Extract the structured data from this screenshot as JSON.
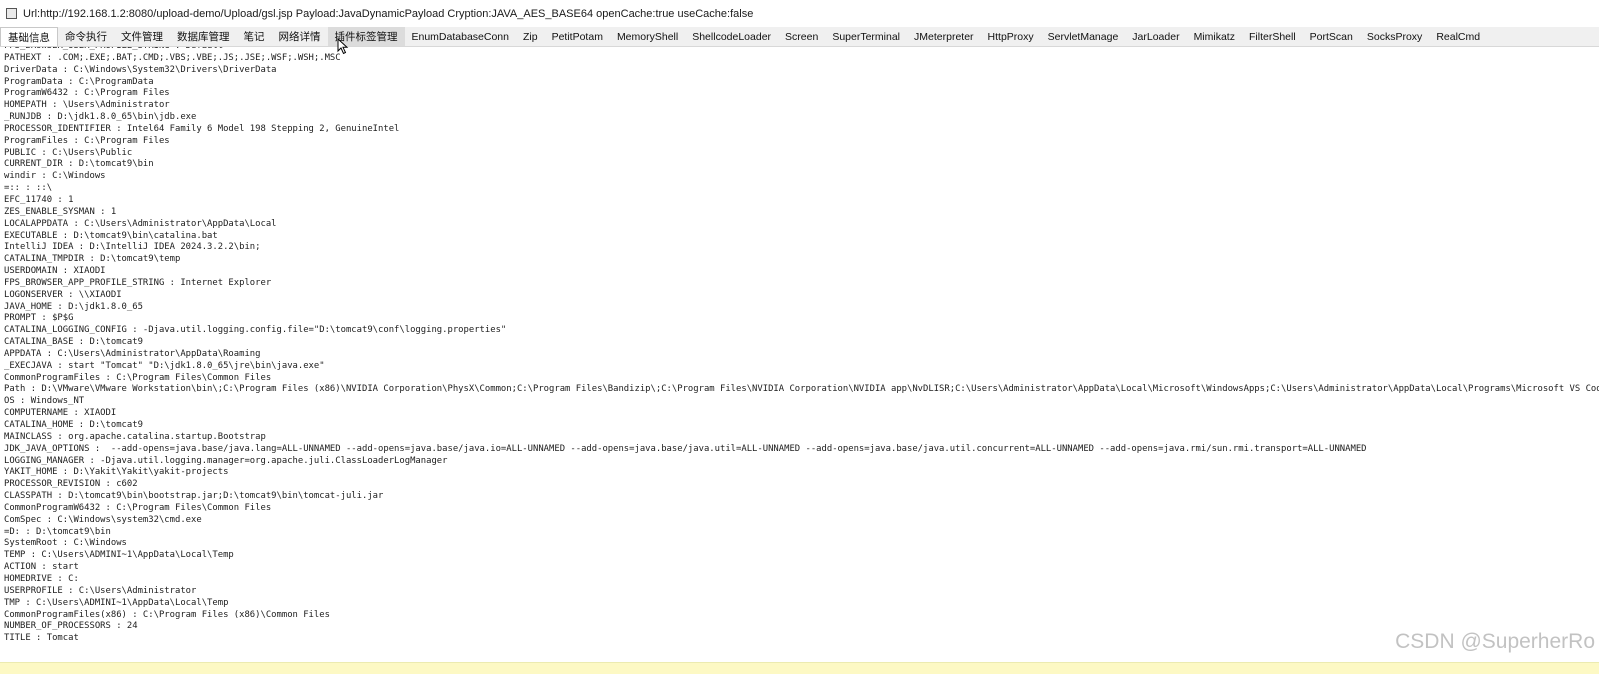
{
  "window": {
    "title": "Url:http://192.168.1.2:8080/upload-demo/Upload/gsl.jsp Payload:JavaDynamicPayload Cryption:JAVA_AES_BASE64 openCache:true useCache:false",
    "app_icon": "window-app-icon"
  },
  "tabs": [
    {
      "label": "基础信息",
      "state": "active"
    },
    {
      "label": "命令执行",
      "state": "normal"
    },
    {
      "label": "文件管理",
      "state": "normal"
    },
    {
      "label": "数据库管理",
      "state": "normal"
    },
    {
      "label": "笔记",
      "state": "normal"
    },
    {
      "label": "网络详情",
      "state": "normal"
    },
    {
      "label": "插件标签管理",
      "state": "hover"
    },
    {
      "label": "EnumDatabaseConn",
      "state": "normal"
    },
    {
      "label": "Zip",
      "state": "normal"
    },
    {
      "label": "PetitPotam",
      "state": "normal"
    },
    {
      "label": "MemoryShell",
      "state": "normal"
    },
    {
      "label": "ShellcodeLoader",
      "state": "normal"
    },
    {
      "label": "Screen",
      "state": "normal"
    },
    {
      "label": "SuperTerminal",
      "state": "normal"
    },
    {
      "label": "JMeterpreter",
      "state": "normal"
    },
    {
      "label": "HttpProxy",
      "state": "normal"
    },
    {
      "label": "ServletManage",
      "state": "normal"
    },
    {
      "label": "JarLoader",
      "state": "normal"
    },
    {
      "label": "Mimikatz",
      "state": "normal"
    },
    {
      "label": "FilterShell",
      "state": "normal"
    },
    {
      "label": "PortScan",
      "state": "normal"
    },
    {
      "label": "SocksProxy",
      "state": "normal"
    },
    {
      "label": "RealCmd",
      "state": "normal"
    }
  ],
  "output_lines": [
    "FPS_BROWSER_USER_PROFILE_STRING : Default",
    "PATHEXT : .COM;.EXE;.BAT;.CMD;.VBS;.VBE;.JS;.JSE;.WSF;.WSH;.MSC",
    "DriverData : C:\\Windows\\System32\\Drivers\\DriverData",
    "ProgramData : C:\\ProgramData",
    "ProgramW6432 : C:\\Program Files",
    "HOMEPATH : \\Users\\Administrator",
    "_RUNJDB : D:\\jdk1.8.0_65\\bin\\jdb.exe",
    "PROCESSOR_IDENTIFIER : Intel64 Family 6 Model 198 Stepping 2, GenuineIntel",
    "ProgramFiles : C:\\Program Files",
    "PUBLIC : C:\\Users\\Public",
    "CURRENT_DIR : D:\\tomcat9\\bin",
    "windir : C:\\Windows",
    "=:: : ::\\",
    "EFC_11740 : 1",
    "ZES_ENABLE_SYSMAN : 1",
    "LOCALAPPDATA : C:\\Users\\Administrator\\AppData\\Local",
    "EXECUTABLE : D:\\tomcat9\\bin\\catalina.bat",
    "IntelliJ IDEA : D:\\IntelliJ IDEA 2024.3.2.2\\bin;",
    "CATALINA_TMPDIR : D:\\tomcat9\\temp",
    "USERDOMAIN : XIAODI",
    "FPS_BROWSER_APP_PROFILE_STRING : Internet Explorer",
    "LOGONSERVER : \\\\XIAODI",
    "JAVA_HOME : D:\\jdk1.8.0_65",
    "PROMPT : $P$G",
    "CATALINA_LOGGING_CONFIG : -Djava.util.logging.config.file=\"D:\\tomcat9\\conf\\logging.properties\"",
    "CATALINA_BASE : D:\\tomcat9",
    "APPDATA : C:\\Users\\Administrator\\AppData\\Roaming",
    "_EXECJAVA : start \"Tomcat\" \"D:\\jdk1.8.0_65\\jre\\bin\\java.exe\"",
    "CommonProgramFiles : C:\\Program Files\\Common Files",
    "Path : D:\\VMware\\VMware Workstation\\bin\\;C:\\Program Files (x86)\\NVIDIA Corporation\\PhysX\\Common;C:\\Program Files\\Bandizip\\;C:\\Program Files\\NVIDIA Corporation\\NVIDIA app\\NvDLISR;C:\\Users\\Administrator\\AppData\\Local\\Microsoft\\WindowsApps;C:\\Users\\Administrator\\AppData\\Local\\Programs\\Microsoft VS Code\\bin",
    "OS : Windows_NT",
    "COMPUTERNAME : XIAODI",
    "CATALINA_HOME : D:\\tomcat9",
    "MAINCLASS : org.apache.catalina.startup.Bootstrap",
    "JDK_JAVA_OPTIONS :  --add-opens=java.base/java.lang=ALL-UNNAMED --add-opens=java.base/java.io=ALL-UNNAMED --add-opens=java.base/java.util=ALL-UNNAMED --add-opens=java.base/java.util.concurrent=ALL-UNNAMED --add-opens=java.rmi/sun.rmi.transport=ALL-UNNAMED",
    "LOGGING_MANAGER : -Djava.util.logging.manager=org.apache.juli.ClassLoaderLogManager",
    "YAKIT_HOME : D:\\Yakit\\Yakit\\yakit-projects",
    "PROCESSOR_REVISION : c602",
    "CLASSPATH : D:\\tomcat9\\bin\\bootstrap.jar;D:\\tomcat9\\bin\\tomcat-juli.jar",
    "CommonProgramW6432 : C:\\Program Files\\Common Files",
    "ComSpec : C:\\Windows\\system32\\cmd.exe",
    "=D: : D:\\tomcat9\\bin",
    "SystemRoot : C:\\Windows",
    "TEMP : C:\\Users\\ADMINI~1\\AppData\\Local\\Temp",
    "ACTION : start",
    "HOMEDRIVE : C:",
    "USERPROFILE : C:\\Users\\Administrator",
    "TMP : C:\\Users\\ADMINI~1\\AppData\\Local\\Temp",
    "CommonProgramFiles(x86) : C:\\Program Files (x86)\\Common Files",
    "NUMBER_OF_PROCESSORS : 24",
    "TITLE : Tomcat"
  ],
  "watermark": "CSDN @SuperherRo",
  "cursor_icon": "mouse-pointer-icon",
  "colors": {
    "tab_bar_bg": "#f0f0f0",
    "active_tab_bg": "#ffffff",
    "hover_tab_bg": "#dcdcdc",
    "status_bar_bg": "#fdf9c4",
    "text": "#202020"
  }
}
